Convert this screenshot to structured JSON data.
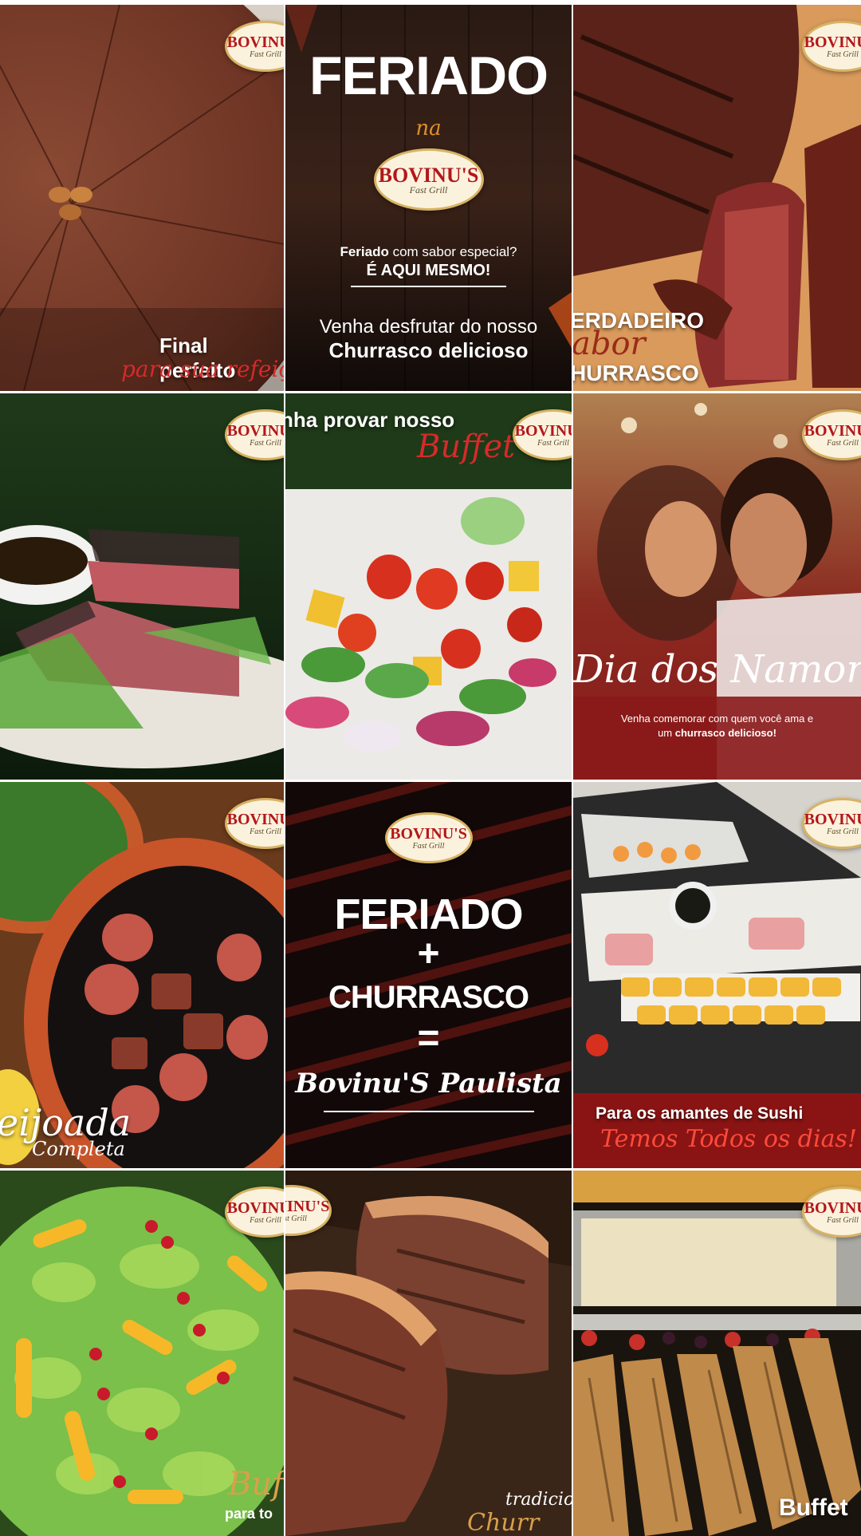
{
  "brand": {
    "name": "BOVINU'S",
    "tag": "Fast Grill"
  },
  "posts": [
    {
      "id": "post-1",
      "title": "Final perfeito",
      "subtitle": "para sua refeição"
    },
    {
      "id": "post-2",
      "title": "FERIADO",
      "na": "na",
      "question_pre": "Feriado",
      "question_rest": " com sabor especial?",
      "answer": "É AQUI MESMO!",
      "line1": "Venha desfrutar do nosso",
      "line2": "Churrasco delicioso"
    },
    {
      "id": "post-3",
      "line1": "ERDADEIRO",
      "line2": "abor",
      "line3": "HURRASCO"
    },
    {
      "id": "post-4"
    },
    {
      "id": "post-5",
      "title": "nha provar nosso",
      "script": "Buffet"
    },
    {
      "id": "post-6",
      "script": "Dia dos Namorados",
      "line1": "Venha comemorar com quem você ama e",
      "line2_pre": "um ",
      "line2_bold": "churrasco delicioso!"
    },
    {
      "id": "post-7",
      "title": "eijoada",
      "script": "Completa"
    },
    {
      "id": "post-8",
      "line1": "FERIADO",
      "plus": "+",
      "line2": "CHURRASCO",
      "eq": "=",
      "script": "Bovinu'S Paulista"
    },
    {
      "id": "post-9",
      "title": "Para os amantes de Sushi",
      "script": "Temos Todos os dias!"
    },
    {
      "id": "post-10",
      "script": "Buf",
      "small": "para to"
    },
    {
      "id": "post-11",
      "script": "tradicio",
      "script2": "Churr"
    },
    {
      "id": "post-12",
      "title": "Buffet"
    }
  ]
}
